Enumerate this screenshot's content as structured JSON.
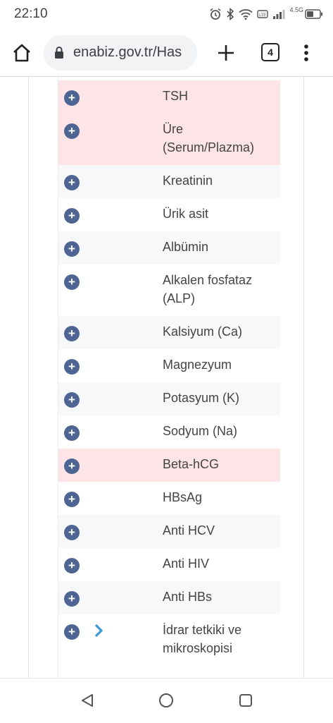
{
  "status_bar": {
    "time": "22:10",
    "network_label": "4.5G"
  },
  "browser": {
    "url": "enabiz.gov.tr/Has",
    "tab_count": "4"
  },
  "tests": [
    {
      "name": "TSH",
      "highlight": true
    },
    {
      "name": "Üre (Serum/Plazma)",
      "highlight": true
    },
    {
      "name": "Kreatinin",
      "highlight": false
    },
    {
      "name": "Ürik asit",
      "highlight": false
    },
    {
      "name": "Albümin",
      "highlight": false
    },
    {
      "name": "Alkalen fosfataz (ALP)",
      "highlight": false
    },
    {
      "name": "Kalsiyum (Ca)",
      "highlight": false
    },
    {
      "name": "Magnezyum",
      "highlight": false
    },
    {
      "name": "Potasyum (K)",
      "highlight": false
    },
    {
      "name": "Sodyum (Na)",
      "highlight": false
    },
    {
      "name": "Beta-hCG",
      "highlight": true
    },
    {
      "name": "HBsAg",
      "highlight": false
    },
    {
      "name": "Anti HCV",
      "highlight": false
    },
    {
      "name": "Anti HIV",
      "highlight": false
    },
    {
      "name": "Anti HBs",
      "highlight": false
    },
    {
      "name": "İdrar tetkiki ve mikroskopisi",
      "highlight": false,
      "has_chevron": true
    }
  ],
  "colors": {
    "highlight_row": "#fde4e6",
    "add_button": "#4e6594",
    "chevron": "#3a9ad9"
  },
  "icons": {
    "add": "plus-circle-icon",
    "expand": "chevron-right-icon"
  }
}
